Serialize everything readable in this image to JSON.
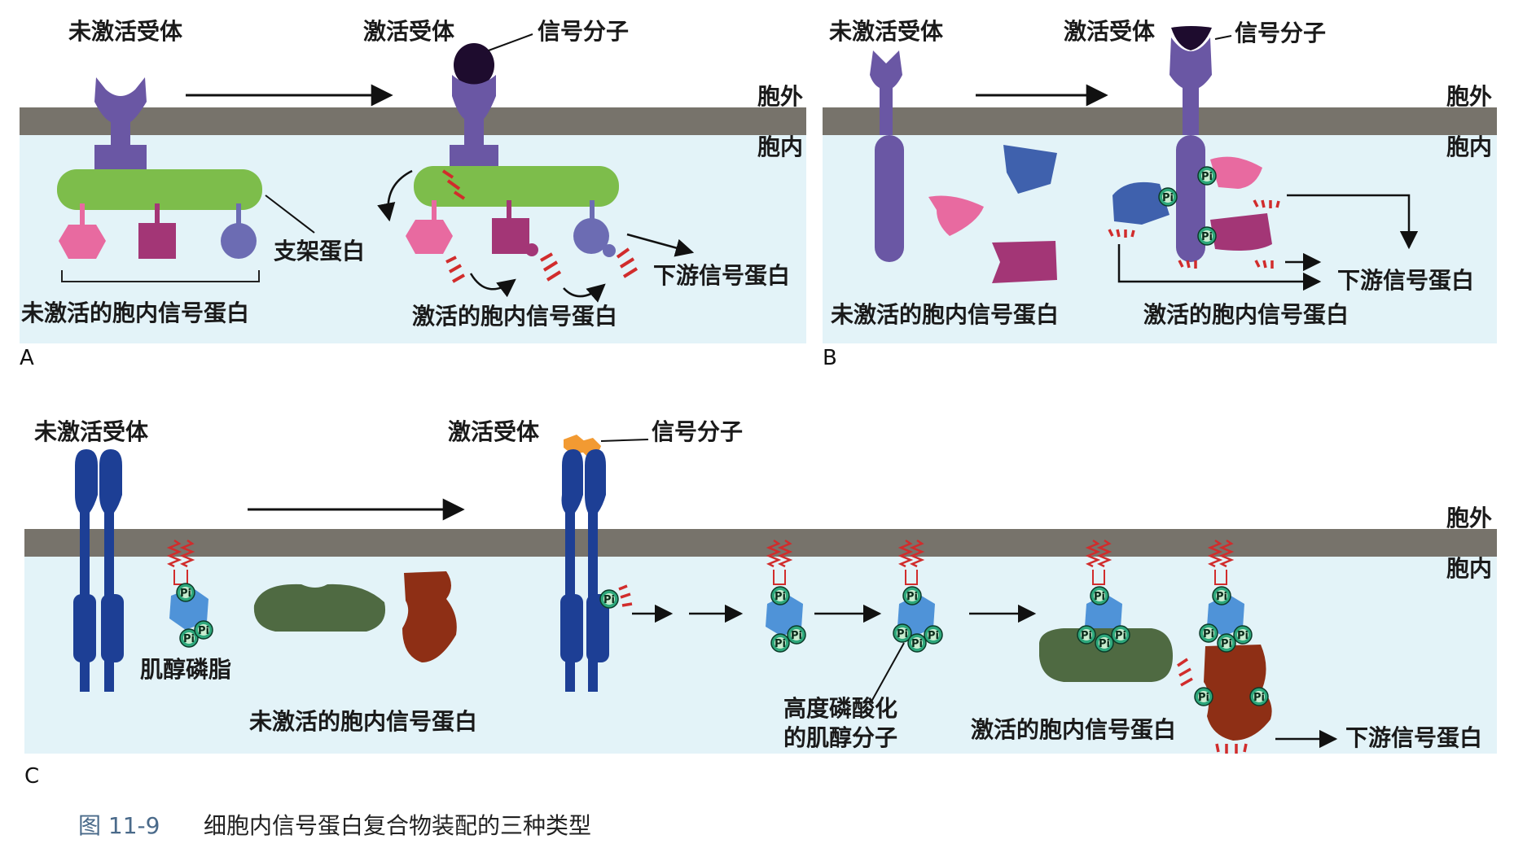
{
  "colors": {
    "membrane": "#77736b",
    "cytoplasm": "#e3f3f8",
    "receptor_purple": "#6a57a4",
    "scaffold_green": "#7dbd4b",
    "pink": "#e86aa0",
    "magenta": "#a33676",
    "blue_purple": "#6c6cb3",
    "receptor_navy": "#1d3f95",
    "light_blue": "#4f93d8",
    "dark_green": "#4f6a42",
    "brown": "#8e2f15",
    "orange": "#f29a32",
    "red_marks": "#d12c2c"
  },
  "panelA": {
    "letter": "A",
    "inactive_receptor": "未激活受体",
    "active_receptor": "激活受体",
    "signal_molecule": "信号分子",
    "outside": "胞外",
    "inside": "胞内",
    "scaffold_protein": "支架蛋白",
    "inactive_proteins": "未激活的胞内信号蛋白",
    "active_proteins": "激活的胞内信号蛋白",
    "downstream": "下游信号蛋白"
  },
  "panelB": {
    "letter": "B",
    "inactive_receptor": "未激活受体",
    "active_receptor": "激活受体",
    "signal_molecule": "信号分子",
    "outside": "胞外",
    "inside": "胞内",
    "inactive_proteins": "未激活的胞内信号蛋白",
    "active_proteins": "激活的胞内信号蛋白",
    "downstream": "下游信号蛋白",
    "pi": "Pi"
  },
  "panelC": {
    "letter": "C",
    "inactive_receptor": "未激活受体",
    "active_receptor": "激活受体",
    "signal_molecule": "信号分子",
    "outside": "胞外",
    "inside": "胞内",
    "phosphoinositide": "肌醇磷脂",
    "inactive_proteins": "未激活的胞内信号蛋白",
    "highly_phosphorylated_line1": "高度磷酸化",
    "highly_phosphorylated_line2": "的肌醇分子",
    "active_proteins": "激活的胞内信号蛋白",
    "downstream": "下游信号蛋白",
    "pi": "Pi"
  },
  "caption": {
    "number": "图 11-9",
    "text": "细胞内信号蛋白复合物装配的三种类型"
  }
}
